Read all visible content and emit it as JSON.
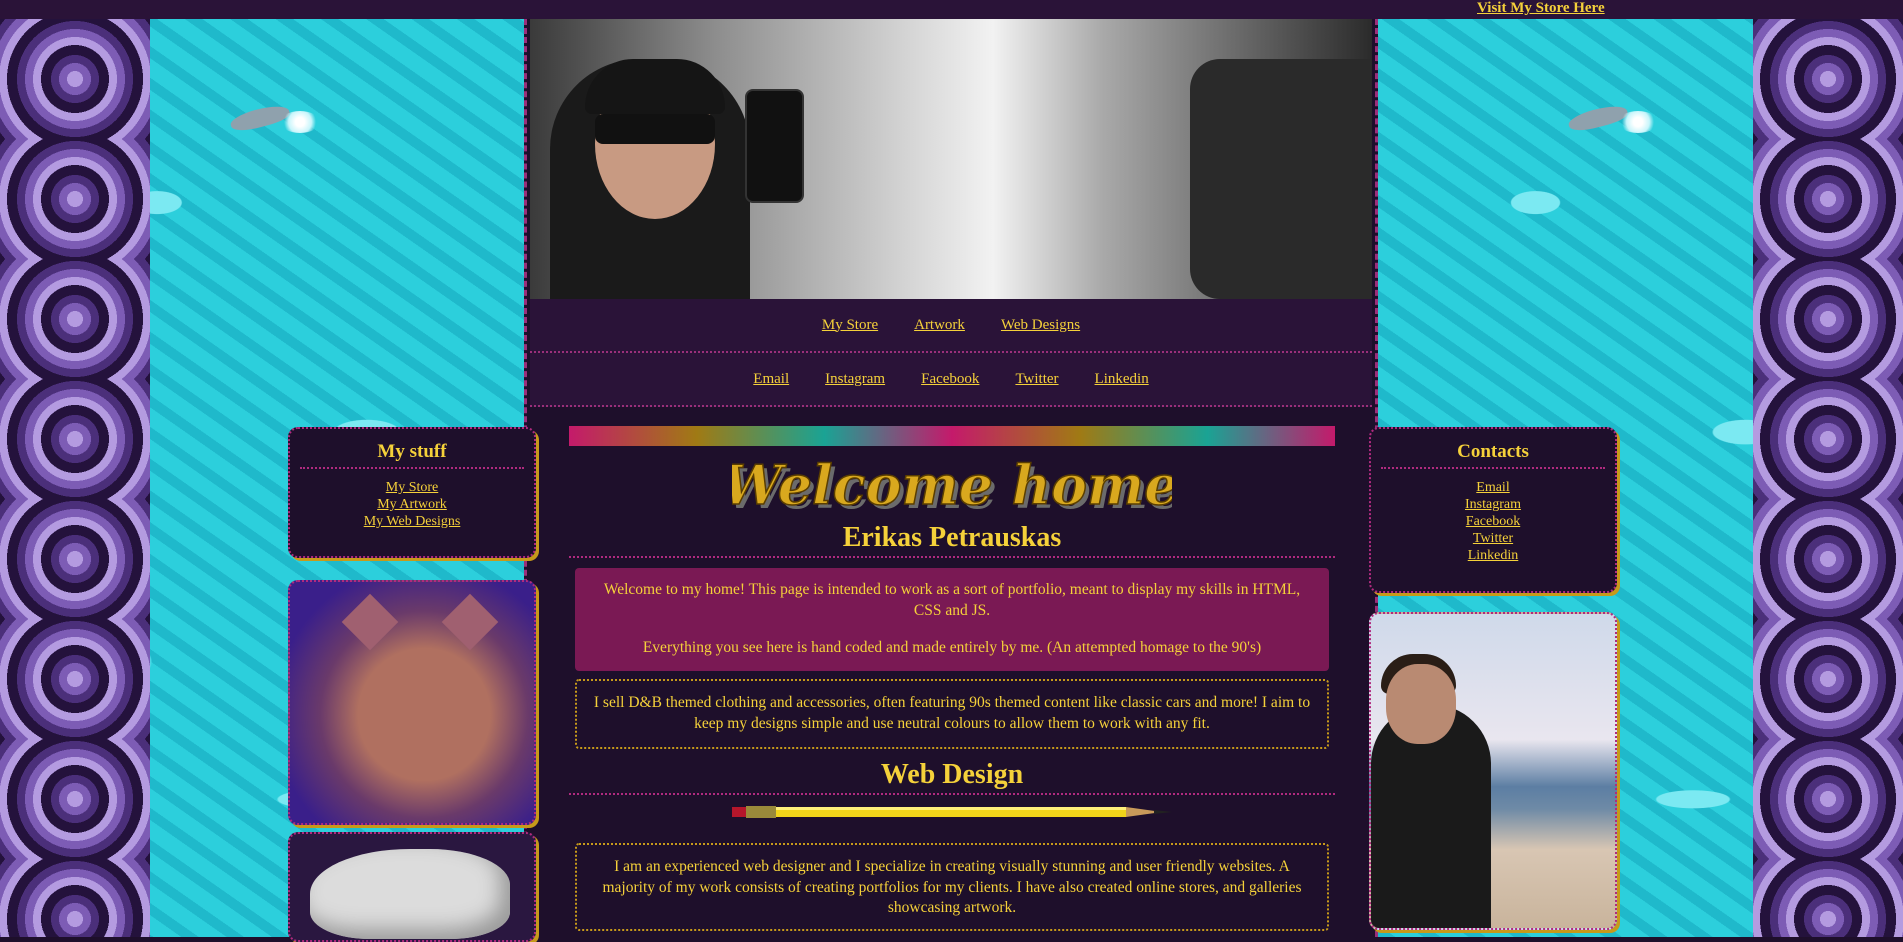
{
  "top": {
    "store_link": "Visit My Store Here"
  },
  "nav_primary": [
    "My Store",
    "Artwork",
    "Web Designs"
  ],
  "nav_social": [
    "Email",
    "Instagram",
    "Facebook",
    "Twitter",
    "Linkedin"
  ],
  "left_panel": {
    "title": "My stuff",
    "links": [
      "My Store",
      "My Artwork",
      "My Web Designs"
    ]
  },
  "right_panel": {
    "title": "Contacts",
    "links": [
      "Email",
      "Instagram",
      "Facebook",
      "Twitter",
      "Linkedin"
    ]
  },
  "main": {
    "welcome_image_text": "Welcome home",
    "name": "Erikas Petrauskas",
    "intro_p1": "Welcome to my home! This page is intended to work as a sort of portfolio, meant to display my skills in HTML, CSS and JS.",
    "intro_p2": "Everything you see here is hand coded and made entirely by me. (An attempted homage to the 90's)",
    "store_text": "I sell D&B themed clothing and accessories, often featuring 90s themed content like classic cars and more! I aim to keep my designs simple and use neutral colours to allow them to work with any fit.",
    "section_title": "Web Design",
    "web_text": "I am an experienced web designer and I specialize in creating visually stunning and user friendly websites. A majority of my work consists of creating portfolios for my clients. I have also created online stores, and galleries showcasing artwork."
  },
  "colors": {
    "background": "#1e0f2b",
    "accent_text": "#f5d13a",
    "magenta_box": "#7a1954",
    "dotted_border": "#b02a7f",
    "gold_border": "#c79a1a",
    "water": "#23c7d7"
  }
}
